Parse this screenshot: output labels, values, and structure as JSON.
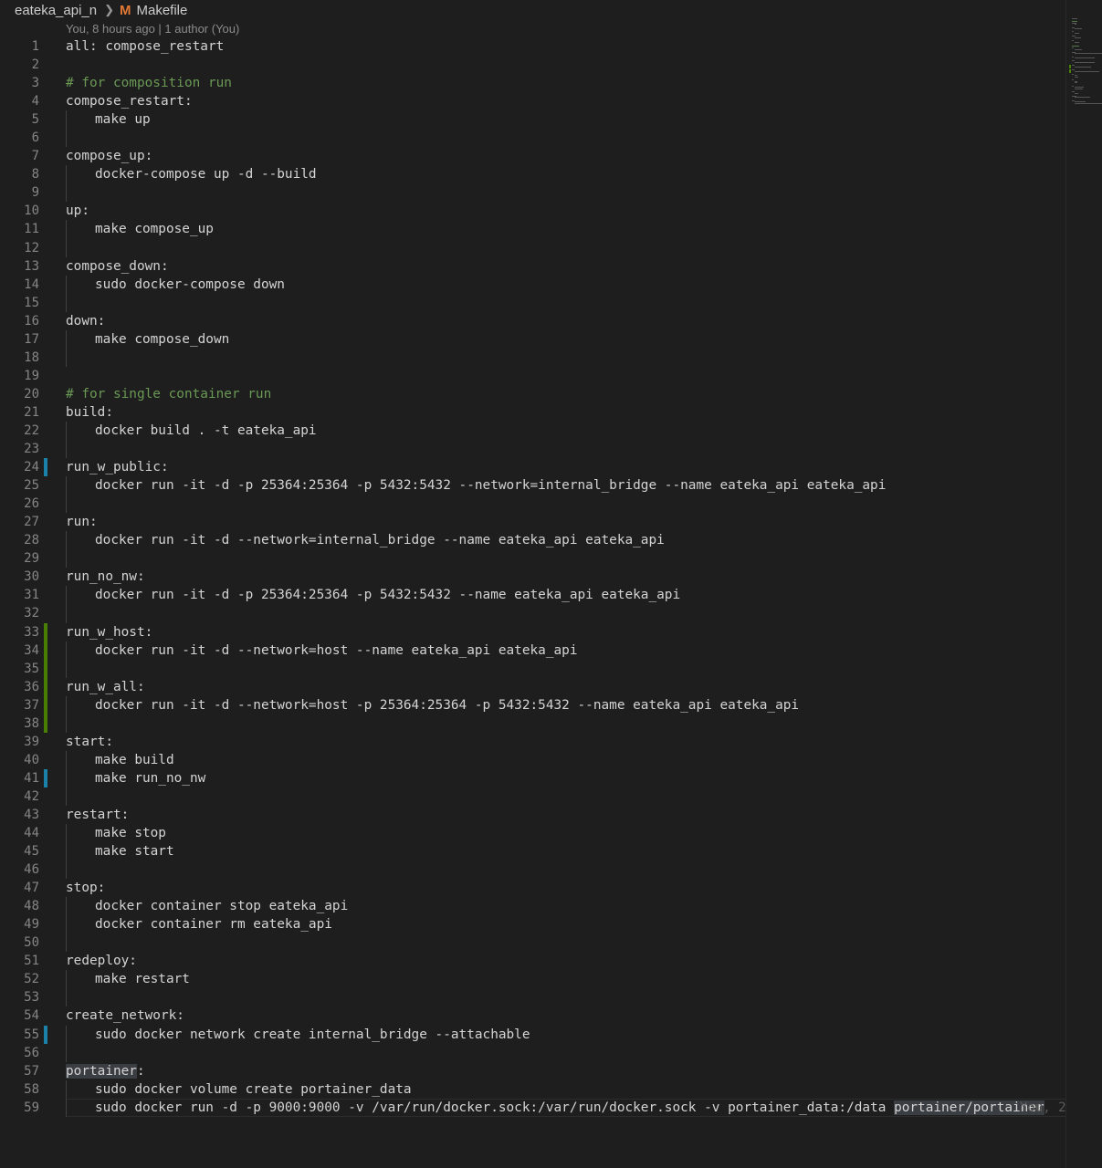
{
  "breadcrumb": {
    "folder": "eateka_api_n",
    "file": "Makefile",
    "file_icon_glyph": "M",
    "file_icon_color": "#e37933"
  },
  "blame_header": "You, 8 hours ago | 1 author (You)",
  "ghost_text": "You, 2",
  "lines": [
    {
      "n": "1",
      "text": "all: compose_restart",
      "indent": false
    },
    {
      "n": "2",
      "text": "",
      "indent": false
    },
    {
      "n": "3",
      "text": "# for composition run",
      "indent": false,
      "comment": true
    },
    {
      "n": "4",
      "text": "compose_restart:",
      "indent": false
    },
    {
      "n": "5",
      "text": "make up",
      "indent": true
    },
    {
      "n": "6",
      "text": "",
      "indent": true
    },
    {
      "n": "7",
      "text": "compose_up:",
      "indent": false
    },
    {
      "n": "8",
      "text": "docker-compose up -d --build",
      "indent": true
    },
    {
      "n": "9",
      "text": "",
      "indent": true
    },
    {
      "n": "10",
      "text": "up:",
      "indent": false
    },
    {
      "n": "11",
      "text": "make compose_up",
      "indent": true
    },
    {
      "n": "12",
      "text": "",
      "indent": true
    },
    {
      "n": "13",
      "text": "compose_down:",
      "indent": false
    },
    {
      "n": "14",
      "text": "sudo docker-compose down",
      "indent": true
    },
    {
      "n": "15",
      "text": "",
      "indent": true
    },
    {
      "n": "16",
      "text": "down:",
      "indent": false
    },
    {
      "n": "17",
      "text": "make compose_down",
      "indent": true
    },
    {
      "n": "18",
      "text": "",
      "indent": true
    },
    {
      "n": "19",
      "text": "",
      "indent": false
    },
    {
      "n": "20",
      "text": "# for single container run",
      "indent": false,
      "comment": true
    },
    {
      "n": "21",
      "text": "build:",
      "indent": false
    },
    {
      "n": "22",
      "text": "docker build . -t eateka_api",
      "indent": true
    },
    {
      "n": "23",
      "text": "",
      "indent": true
    },
    {
      "n": "24",
      "text": "run_w_public:",
      "indent": false,
      "mark": "mod"
    },
    {
      "n": "25",
      "text": "docker run -it -d -p 25364:25364 -p 5432:5432 --network=internal_bridge --name eateka_api eateka_api",
      "indent": true
    },
    {
      "n": "26",
      "text": "",
      "indent": true
    },
    {
      "n": "27",
      "text": "run:",
      "indent": false
    },
    {
      "n": "28",
      "text": "docker run -it -d --network=internal_bridge --name eateka_api eateka_api",
      "indent": true
    },
    {
      "n": "29",
      "text": "",
      "indent": true
    },
    {
      "n": "30",
      "text": "run_no_nw:",
      "indent": false
    },
    {
      "n": "31",
      "text": "docker run -it -d -p 25364:25364 -p 5432:5432 --name eateka_api eateka_api",
      "indent": true
    },
    {
      "n": "32",
      "text": "",
      "indent": true
    },
    {
      "n": "33",
      "text": "run_w_host:",
      "indent": false,
      "mark": "add"
    },
    {
      "n": "34",
      "text": "docker run -it -d --network=host --name eateka_api eateka_api",
      "indent": true,
      "mark": "add"
    },
    {
      "n": "35",
      "text": "",
      "indent": true,
      "mark": "add"
    },
    {
      "n": "36",
      "text": "run_w_all:",
      "indent": false,
      "mark": "add"
    },
    {
      "n": "37",
      "text": "docker run -it -d --network=host -p 25364:25364 -p 5432:5432 --name eateka_api eateka_api",
      "indent": true,
      "mark": "add"
    },
    {
      "n": "38",
      "text": "",
      "indent": true,
      "mark": "add"
    },
    {
      "n": "39",
      "text": "start:",
      "indent": false
    },
    {
      "n": "40",
      "text": "make build",
      "indent": true
    },
    {
      "n": "41",
      "text": "make run_no_nw",
      "indent": true,
      "mark": "mod"
    },
    {
      "n": "42",
      "text": "",
      "indent": true
    },
    {
      "n": "43",
      "text": "restart:",
      "indent": false
    },
    {
      "n": "44",
      "text": "make stop",
      "indent": true
    },
    {
      "n": "45",
      "text": "make start",
      "indent": true
    },
    {
      "n": "46",
      "text": "",
      "indent": true
    },
    {
      "n": "47",
      "text": "stop:",
      "indent": false
    },
    {
      "n": "48",
      "text": "docker container stop eateka_api",
      "indent": true
    },
    {
      "n": "49",
      "text": "docker container rm eateka_api",
      "indent": true
    },
    {
      "n": "50",
      "text": "",
      "indent": true
    },
    {
      "n": "51",
      "text": "redeploy:",
      "indent": false
    },
    {
      "n": "52",
      "text": "make restart",
      "indent": true
    },
    {
      "n": "53",
      "text": "",
      "indent": true
    },
    {
      "n": "54",
      "text": "create_network:",
      "indent": false
    },
    {
      "n": "55",
      "text": "sudo docker network create internal_bridge --attachable",
      "indent": true,
      "mark": "mod"
    },
    {
      "n": "56",
      "text": "",
      "indent": true
    },
    {
      "n": "57",
      "text": "portainer:",
      "indent": false,
      "highlight": "portainer"
    },
    {
      "n": "58",
      "text": "sudo docker volume create portainer_data",
      "indent": true
    },
    {
      "n": "59",
      "text": "sudo docker run -d -p 9000:9000 -v /var/run/docker.sock:/var/run/docker.sock -v portainer_data:/data portainer/portainer",
      "indent": true,
      "highlight": "portainer/portainer",
      "current": true
    }
  ]
}
